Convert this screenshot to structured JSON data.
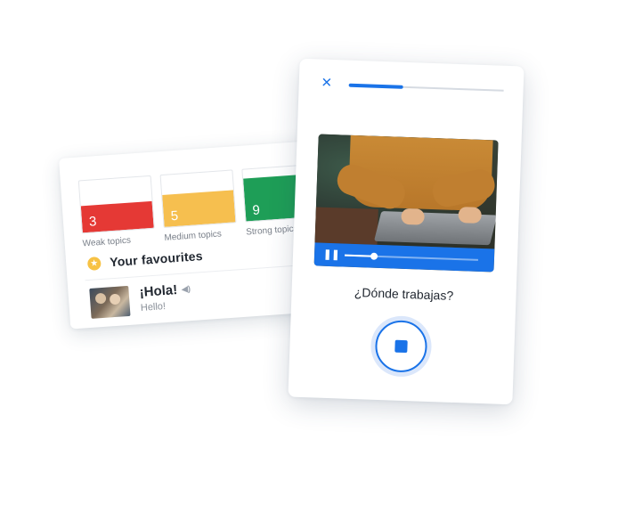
{
  "topics": [
    {
      "count": "3",
      "label": "Weak topics",
      "color": "#e53935"
    },
    {
      "count": "5",
      "label": "Medium topics",
      "color": "#f6bf4f"
    },
    {
      "count": "9",
      "label": "Strong topics",
      "color": "#1e9e57"
    }
  ],
  "favourites": {
    "title": "Your favourites",
    "items": [
      {
        "phrase": "¡Hola!",
        "translation": "Hello!"
      }
    ]
  },
  "lesson": {
    "progress_fraction": 0.35,
    "video_progress_fraction": 0.22,
    "question": "¿Dónde trabajas?",
    "accent_color": "#1a73e8"
  },
  "icons": {
    "close": "close-icon",
    "pause": "pause-icon",
    "stop": "stop-icon",
    "star": "star-icon",
    "speaker": "speaker-icon"
  }
}
